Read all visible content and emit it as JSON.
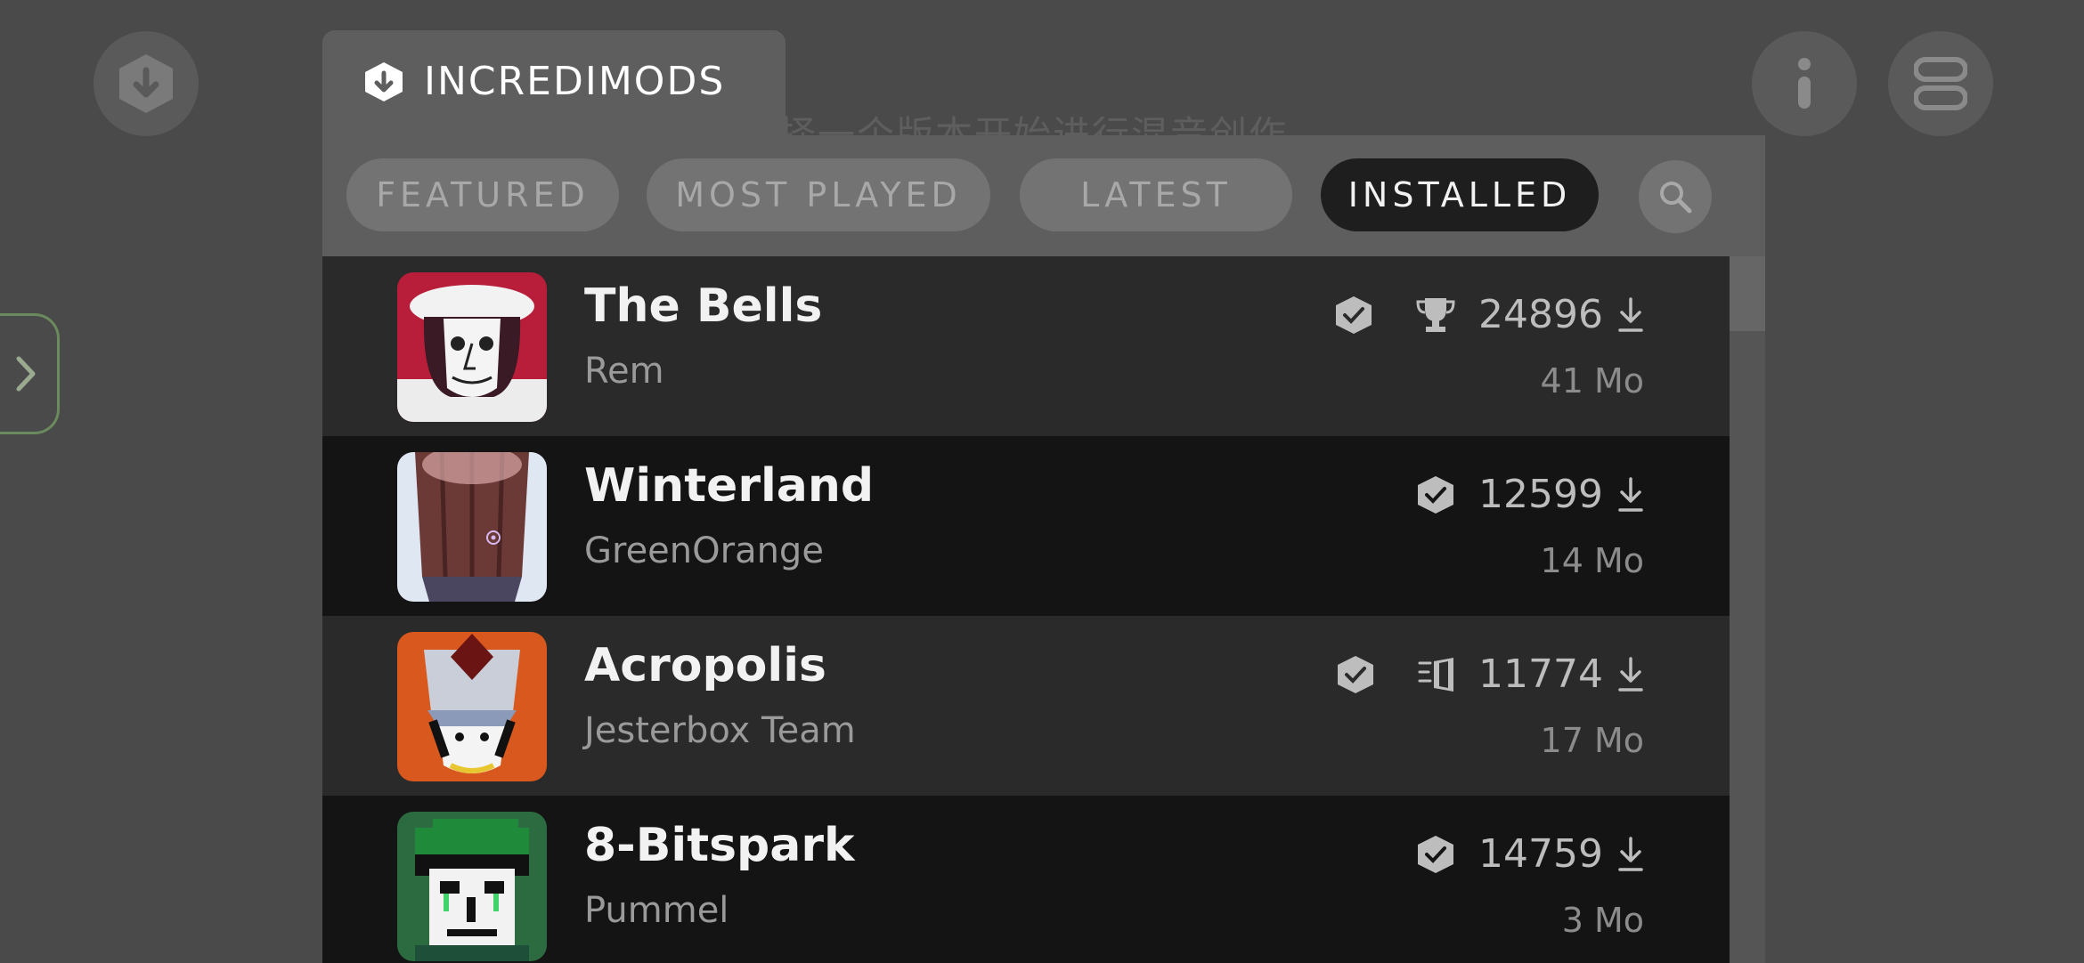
{
  "background": {
    "faded_text": "选择一个版本开始进行混音创作"
  },
  "header": {
    "title": "INCREDIMODS"
  },
  "filters": [
    {
      "label": "FEATURED",
      "active": false
    },
    {
      "label": "MOST PLAYED",
      "active": false
    },
    {
      "label": "LATEST",
      "active": false
    },
    {
      "label": "INSTALLED",
      "active": true
    }
  ],
  "mods": [
    {
      "name": "The Bells",
      "author": "Rem",
      "downloads": "24896",
      "age": "41 Mo",
      "badges": [
        "verified-icon",
        "trophy-icon"
      ]
    },
    {
      "name": "Winterland",
      "author": "GreenOrange",
      "downloads": "12599",
      "age": "14 Mo",
      "badges": [
        "verified-icon"
      ]
    },
    {
      "name": "Acropolis",
      "author": "Jesterbox Team",
      "downloads": "11774",
      "age": "17 Mo",
      "badges": [
        "verified-icon",
        "open-door-icon"
      ]
    },
    {
      "name": "8-Bitspark",
      "author": "Pummel",
      "downloads": "14759",
      "age": "3 Mo",
      "badges": [
        "verified-icon"
      ]
    }
  ],
  "colors": {
    "active_pill": "#1e1e1e",
    "pill": "#737373",
    "row_light": "#2a2a2a",
    "row_dark": "#141414",
    "sidebar_accent": "#6b8a5e"
  }
}
